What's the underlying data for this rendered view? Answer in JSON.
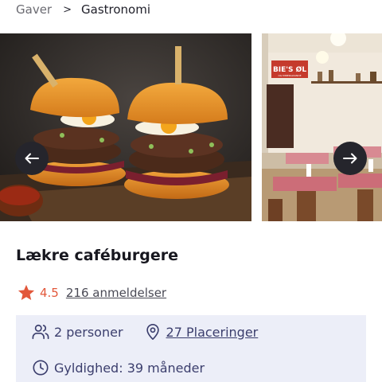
{
  "breadcrumb": {
    "parent": "Gaver",
    "separator": ">",
    "current": "Gastronomi"
  },
  "carousel": {
    "prev_icon": "arrow-left-icon",
    "next_icon": "arrow-right-icon",
    "slide_2_sign": "BIE'S ØL",
    "slide_2_sign_sub": "OG MINERALVANDE"
  },
  "product": {
    "title": "Lækre caféburgere"
  },
  "rating": {
    "icon": "star-icon",
    "value": "4.5",
    "reviews_label": "216 anmeldelser"
  },
  "info": {
    "persons_icon": "people-icon",
    "persons": "2 personer",
    "locations_icon": "location-pin-icon",
    "locations": "27 Placeringer",
    "validity_icon": "clock-icon",
    "validity": "Gyldighed: 39 måneder"
  },
  "colors": {
    "accent": "#e2573a",
    "info_bg": "#eceef8",
    "info_text": "#3b3e6d",
    "nav_button": "#25252c"
  }
}
